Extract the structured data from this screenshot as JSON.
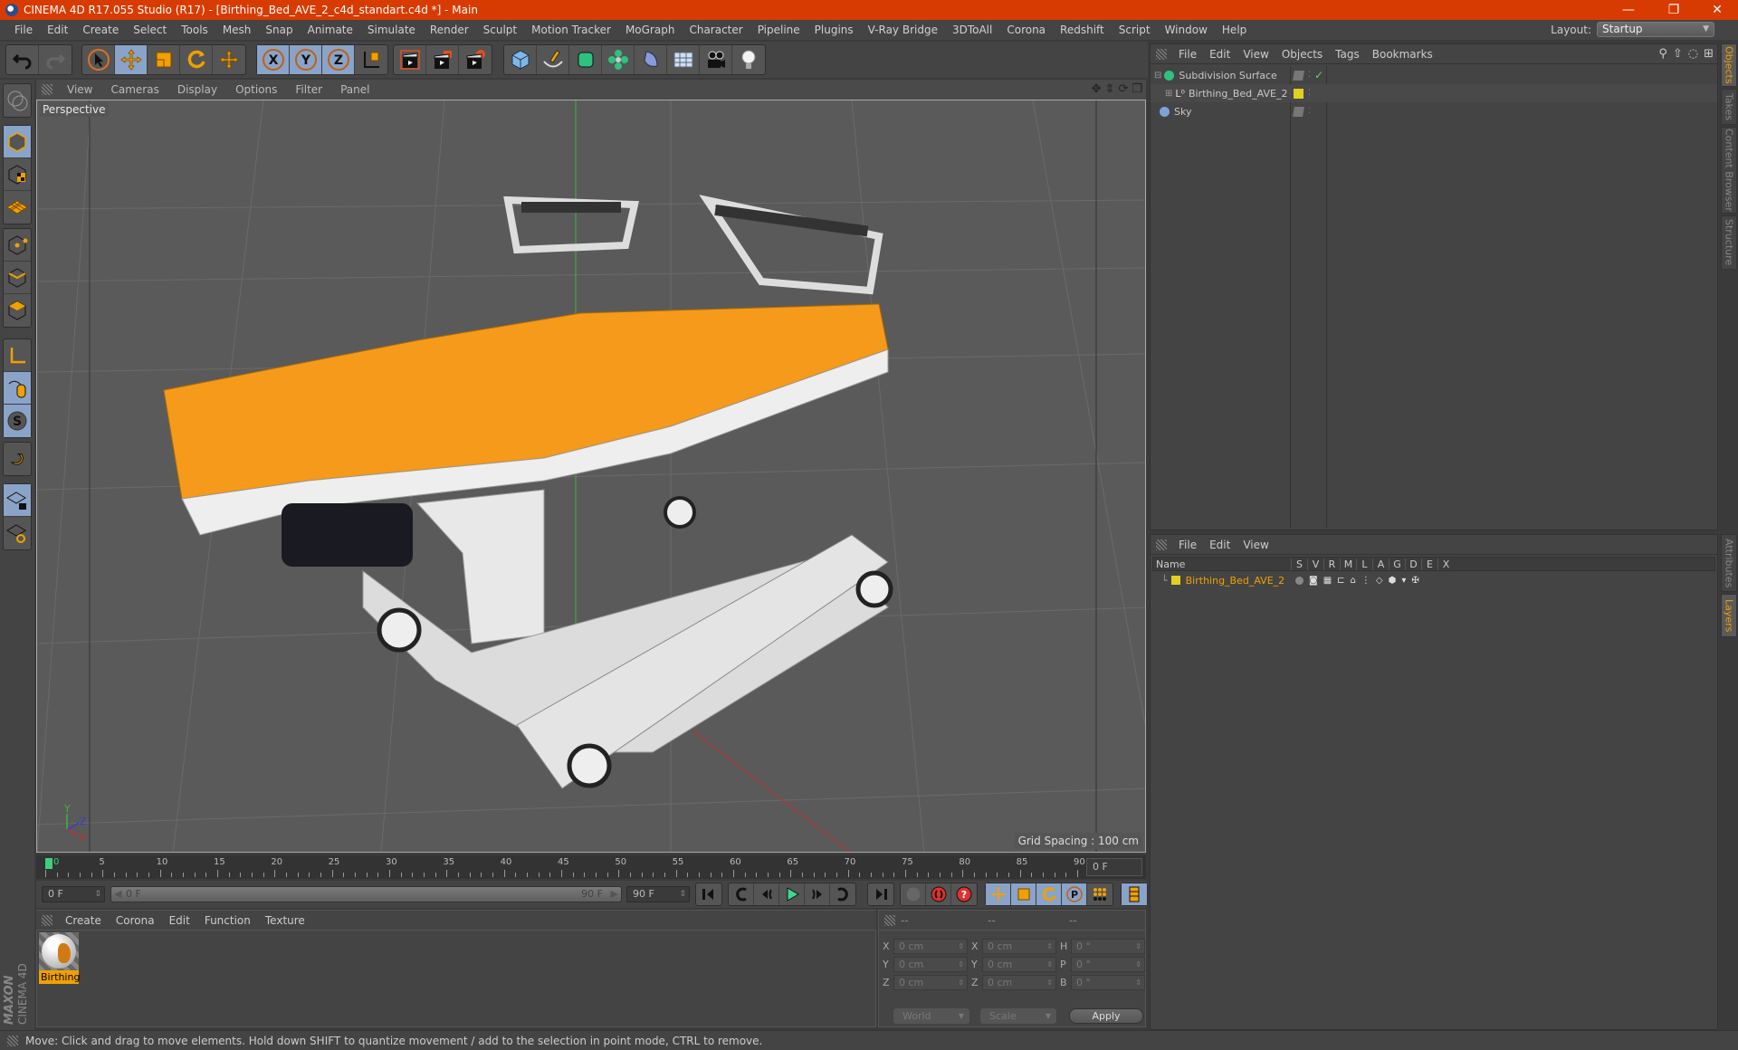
{
  "window": {
    "title": "CINEMA 4D R17.055 Studio (R17) - [Birthing_Bed_AVE_2_c4d_standart.c4d *] - Main",
    "minimize": "—",
    "restore": "❐",
    "close": "✕"
  },
  "menubar": [
    "File",
    "Edit",
    "Create",
    "Select",
    "Tools",
    "Mesh",
    "Snap",
    "Animate",
    "Simulate",
    "Render",
    "Sculpt",
    "Motion Tracker",
    "MoGraph",
    "Character",
    "Pipeline",
    "Plugins",
    "V-Ray Bridge",
    "3DToAll",
    "Corona",
    "Redshift",
    "Script",
    "Window",
    "Help"
  ],
  "layout": {
    "label": "Layout:",
    "value": "Startup"
  },
  "toolbar": {
    "groups": [
      [
        "undo-icon",
        "redo-icon"
      ],
      [
        "select-icon",
        "move-icon",
        "scale-icon",
        "rotate-icon",
        "transform-icon"
      ],
      [
        "x-axis-icon",
        "y-axis-icon",
        "z-axis-icon",
        "coordinate-system-icon"
      ],
      [
        "render-view-icon",
        "render-picture-viewer-icon",
        "render-settings-icon"
      ],
      [
        "cube-icon",
        "pen-spline-icon",
        "subdivision-icon",
        "cloner-icon",
        "deformer-icon",
        "floor-icon",
        "camera-icon",
        "light-icon"
      ]
    ]
  },
  "lefttools": [
    "make-editable-icon",
    "model-mode-icon",
    "texture-mode-icon",
    "workplane-mode-icon",
    "points-mode-icon",
    "edges-mode-icon",
    "polygons-mode-icon",
    "axis-mode-icon",
    "tweak-mode-icon",
    "solo-icon",
    "snap-icon",
    "lock-workplane-icon",
    "workplane-sync-icon"
  ],
  "viewport": {
    "menu": [
      "View",
      "Cameras",
      "Display",
      "Options",
      "Filter",
      "Panel"
    ],
    "label": "Perspective",
    "grid_spacing": "Grid Spacing : 100 cm",
    "axis": {
      "y": "Y",
      "z": "Z",
      "x": "X"
    }
  },
  "timeline": {
    "ticks": [
      "0",
      "5",
      "10",
      "15",
      "20",
      "25",
      "30",
      "35",
      "40",
      "45",
      "50",
      "55",
      "60",
      "65",
      "70",
      "75",
      "80",
      "85",
      "90"
    ],
    "current_frame": "0 F",
    "start_field": "0 F",
    "range_start": "0 F",
    "range_end": "90 F",
    "end_field": "90 F"
  },
  "material_manager": {
    "menu": [
      "Create",
      "Corona",
      "Edit",
      "Function",
      "Texture"
    ],
    "materials": [
      {
        "name": "Birthing"
      }
    ]
  },
  "coordinates": {
    "headers": [
      "--",
      "--",
      "--"
    ],
    "rows": [
      {
        "a": "X",
        "av": "0 cm",
        "b": "X",
        "bv": "0 cm",
        "c": "H",
        "cv": "0 °"
      },
      {
        "a": "Y",
        "av": "0 cm",
        "b": "Y",
        "bv": "0 cm",
        "c": "P",
        "cv": "0 °"
      },
      {
        "a": "Z",
        "av": "0 cm",
        "b": "Z",
        "bv": "0 cm",
        "c": "B",
        "cv": "0 °"
      }
    ],
    "mode": "World",
    "scale": "Scale",
    "apply": "Apply"
  },
  "object_manager": {
    "menu": [
      "File",
      "Edit",
      "View",
      "Objects",
      "Tags",
      "Bookmarks"
    ],
    "objects": [
      {
        "name": "Subdivision Surface",
        "color": "#2ec27e"
      },
      {
        "name": "Birthing_Bed_AVE_2",
        "color": "#e0d020"
      },
      {
        "name": "Sky",
        "color": "#7da4d8"
      }
    ]
  },
  "layer_manager": {
    "menu": [
      "File",
      "Edit",
      "View"
    ],
    "columns": [
      "Name",
      "S",
      "V",
      "R",
      "M",
      "L",
      "A",
      "G",
      "D",
      "E",
      "X"
    ],
    "layers": [
      {
        "name": "Birthing_Bed_AVE_2",
        "color": "#e0d020"
      }
    ]
  },
  "side_tabs": {
    "top": [
      "Objects",
      "Takes",
      "Content Browser",
      "Structure"
    ],
    "bottom": [
      "Attributes",
      "Layers"
    ]
  },
  "status": "Move: Click and drag to move elements. Hold down SHIFT to quantize movement / add to the selection in point mode, CTRL to remove.",
  "brand": {
    "maxon": "MAXON",
    "c4d": "CINEMA 4D"
  },
  "colors": {
    "accent": "#f0a000",
    "titlebar": "#d83b01",
    "active_button": "#8aa3c8"
  }
}
